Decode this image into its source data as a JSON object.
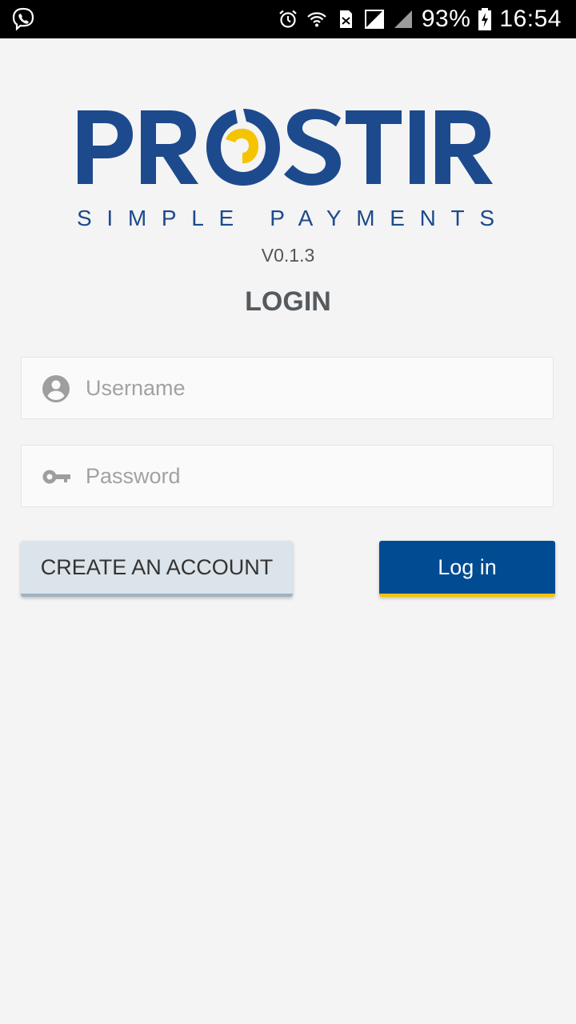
{
  "status_bar": {
    "left_icon": "viber-icon",
    "icons": [
      "alarm-icon",
      "wifi-icon",
      "sim-icon",
      "signal-empty-icon",
      "signal-icon"
    ],
    "battery": "93%",
    "battery_icon": "battery-charging-icon",
    "time": "16:54"
  },
  "logo": {
    "wordmark": "PROSTIR",
    "tagline": "SIMPLE PAYMENTS",
    "colors": {
      "blue": "#1d4a8d",
      "yellow": "#f5c400"
    }
  },
  "version": "V0.1.3",
  "title": "LOGIN",
  "form": {
    "username": {
      "placeholder": "Username",
      "value": "",
      "icon": "account-circle-icon"
    },
    "password": {
      "placeholder": "Password",
      "value": "",
      "icon": "key-icon"
    }
  },
  "buttons": {
    "create_account": "CREATE AN ACCOUNT",
    "login": "Log in"
  },
  "colors": {
    "background": "#f4f4f4",
    "primary": "#004b91",
    "accent": "#f5c400",
    "secondary_button": "#dbe4ea"
  }
}
